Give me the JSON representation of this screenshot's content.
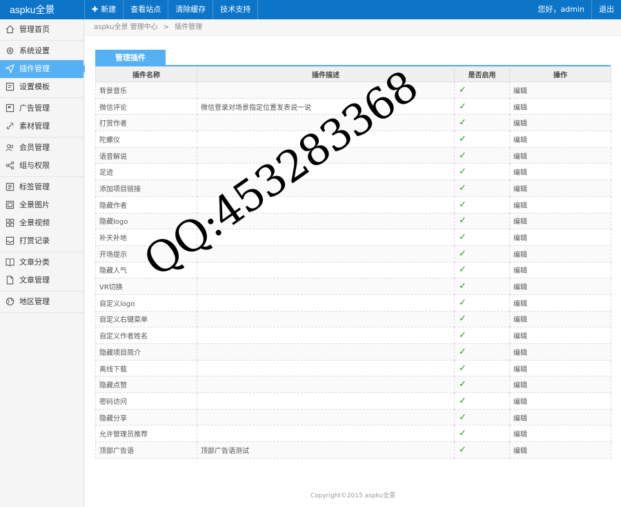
{
  "brand": "aspku全景",
  "topnav": {
    "new": "新建",
    "view_site": "查看站点",
    "clear_cache": "清除缓存",
    "support": "技术支持"
  },
  "user": {
    "greeting": "您好，admin",
    "logout": "退出"
  },
  "sidebar": {
    "groups": [
      [
        {
          "label": "管理首页",
          "icon": "home-icon"
        }
      ],
      [
        {
          "label": "系统设置",
          "icon": "gear-icon"
        },
        {
          "label": "插件管理",
          "icon": "paper-plane-icon",
          "active": true
        },
        {
          "label": "设置模板",
          "icon": "template-icon"
        }
      ],
      [
        {
          "label": "广告管理",
          "icon": "ad-icon"
        },
        {
          "label": "素材管理",
          "icon": "link-icon"
        }
      ],
      [
        {
          "label": "会员管理",
          "icon": "users-icon"
        },
        {
          "label": "组与权限",
          "icon": "share-icon"
        }
      ],
      [
        {
          "label": "标签管理",
          "icon": "tag-list-icon"
        },
        {
          "label": "全景图片",
          "icon": "image-icon"
        },
        {
          "label": "全景视频",
          "icon": "grid-icon"
        },
        {
          "label": "打赏记录",
          "icon": "inbox-icon"
        }
      ],
      [
        {
          "label": "文章分类",
          "icon": "book-icon"
        },
        {
          "label": "文章管理",
          "icon": "file-icon"
        }
      ],
      [
        {
          "label": "地区管理",
          "icon": "globe-icon"
        }
      ]
    ]
  },
  "breadcrumb": {
    "root": "aspku全景 管理中心",
    "sep": ">",
    "current": "插件管理"
  },
  "panel": {
    "tab": "管理插件"
  },
  "table": {
    "headers": [
      "插件名称",
      "插件描述",
      "是否启用",
      "操作"
    ],
    "rows": [
      {
        "name": "背景音乐",
        "desc": "",
        "enabled": "✓",
        "action": "编辑"
      },
      {
        "name": "微信评论",
        "desc": "微信登录对场景指定位置发表说一说",
        "enabled": "✓",
        "action": "编辑"
      },
      {
        "name": "打赏作者",
        "desc": "",
        "enabled": "✓",
        "action": "编辑"
      },
      {
        "name": "陀螺仪",
        "desc": "",
        "enabled": "✓",
        "action": "编辑"
      },
      {
        "name": "语音解说",
        "desc": "",
        "enabled": "✓",
        "action": "编辑"
      },
      {
        "name": "足迹",
        "desc": "",
        "enabled": "✓",
        "action": "编辑"
      },
      {
        "name": "添加项目链接",
        "desc": "",
        "enabled": "✓",
        "action": "编辑"
      },
      {
        "name": "隐藏作者",
        "desc": "",
        "enabled": "✓",
        "action": "编辑"
      },
      {
        "name": "隐藏logo",
        "desc": "",
        "enabled": "✓",
        "action": "编辑"
      },
      {
        "name": "补天补地",
        "desc": "",
        "enabled": "✓",
        "action": "编辑"
      },
      {
        "name": "开场提示",
        "desc": "",
        "enabled": "✓",
        "action": "编辑"
      },
      {
        "name": "隐藏人气",
        "desc": "",
        "enabled": "✓",
        "action": "编辑"
      },
      {
        "name": "VR切换",
        "desc": "",
        "enabled": "✓",
        "action": "编辑"
      },
      {
        "name": "自定义logo",
        "desc": "",
        "enabled": "✓",
        "action": "编辑"
      },
      {
        "name": "自定义右键菜单",
        "desc": "",
        "enabled": "✓",
        "action": "编辑"
      },
      {
        "name": "自定义作者姓名",
        "desc": "",
        "enabled": "✓",
        "action": "编辑"
      },
      {
        "name": "隐藏项目简介",
        "desc": "",
        "enabled": "✓",
        "action": "编辑"
      },
      {
        "name": "离线下载",
        "desc": "",
        "enabled": "✓",
        "action": "编辑"
      },
      {
        "name": "隐藏点赞",
        "desc": "",
        "enabled": "✓",
        "action": "编辑"
      },
      {
        "name": "密码访问",
        "desc": "",
        "enabled": "✓",
        "action": "编辑"
      },
      {
        "name": "隐藏分享",
        "desc": "",
        "enabled": "✓",
        "action": "编辑"
      },
      {
        "name": "允许管理员推荐",
        "desc": "",
        "enabled": "✓",
        "action": "编辑"
      },
      {
        "name": "顶部广告语",
        "desc": "顶部广告语测试",
        "enabled": "✓",
        "action": "编辑"
      }
    ]
  },
  "footer": "Copyright©2015 aspku全景",
  "watermark": "QQ:453283368",
  "colors": {
    "topbar": "#0c75c8",
    "accent": "#55b1f3",
    "check": "#1a9a1a"
  }
}
